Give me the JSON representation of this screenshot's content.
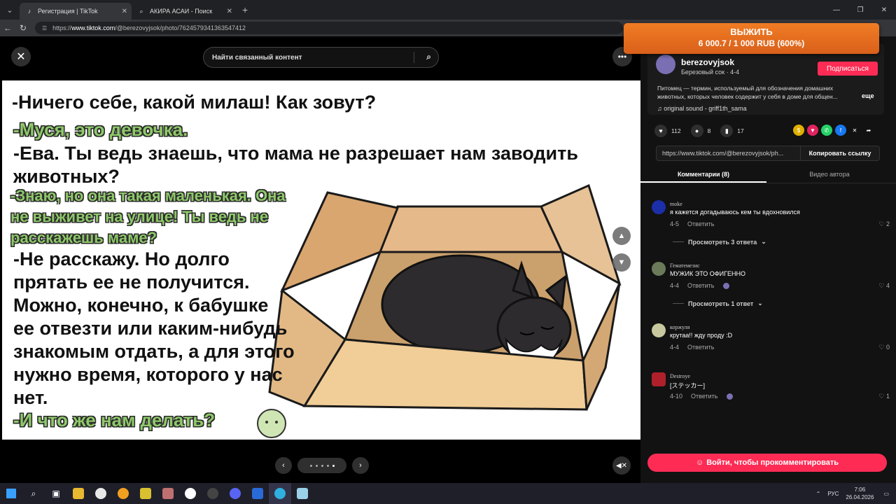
{
  "browser": {
    "tabs": [
      {
        "label": "Регистрация | TikTok",
        "icon": "tiktok-icon",
        "active": true
      },
      {
        "label": "АКИРА АСАИ - Поиск",
        "icon": "search-icon",
        "active": false
      }
    ],
    "url_prefix": "https://",
    "url_host": "www.tiktok.com",
    "url_path": "/@berezovyjsok/photo/7624579341363547412"
  },
  "viewer": {
    "search_placeholder": "Найти связанный контент",
    "comic_lines": [
      {
        "text": "-Ничего себе, какой милаш! Как зовут?",
        "style": "black"
      },
      {
        "text": "-Муся, это девочка.",
        "style": "green"
      },
      {
        "text": "-Ева. Ты ведь знаешь, что мама не разрешает нам заводить",
        "style": "black"
      },
      {
        "text": "животных?",
        "style": "black"
      },
      {
        "text": "-Знаю, но она такая маленькая. Она",
        "style": "green small"
      },
      {
        "text": "не выживет на улице! Ты ведь не",
        "style": "green small"
      },
      {
        "text": "расскажешь маме?",
        "style": "green small"
      },
      {
        "text": "-Не расскажу. Но долго",
        "style": "black"
      },
      {
        "text": "прятать ее не получится.",
        "style": "black"
      },
      {
        "text": "Можно, конечно, к бабушке",
        "style": "black"
      },
      {
        "text": "ее отвезти или каким-нибудь",
        "style": "black"
      },
      {
        "text": "знакомым отдать, а для этого",
        "style": "black"
      },
      {
        "text": "нужно время, которого у нас",
        "style": "black"
      },
      {
        "text": "нет.",
        "style": "black"
      },
      {
        "text": "-И что же нам делать?",
        "style": "green"
      }
    ],
    "pagination": {
      "total": 5,
      "current": 5
    }
  },
  "donation": {
    "title": "ВЫЖИТЬ",
    "progress": "6 000.7 / 1 000 RUB (600%)"
  },
  "author": {
    "name": "berezovyjsok",
    "subtitle": "Березовый сок · 4-4",
    "follow_label": "Подписаться",
    "description": "Питомец — термин, используемый для обозначения домашних животных, которых человек содержит у себя в доме для общен...",
    "more_label": "еще",
    "sound": "original sound - griff1th_sama"
  },
  "stats": {
    "likes": "112",
    "comments": "8",
    "saves": "17"
  },
  "share_link": {
    "url": "https://www.tiktok.com/@berezovyjsok/ph...",
    "copy_label": "Копировать ссылку"
  },
  "comment_tabs": [
    {
      "label": "Комментарии (8)",
      "active": true
    },
    {
      "label": "Видео автора",
      "active": false
    }
  ],
  "comments": [
    {
      "user": "moke",
      "text": "я кажется догадываюсь кем ты вдохновился",
      "date": "4-5",
      "reply": "Ответить",
      "likes": "2",
      "avatar_color": "#1b2fa8",
      "replies_label": "Просмотреть 3 ответа",
      "creator_liked": false
    },
    {
      "user": "Гематемезис",
      "text": "МУЖИК ЭТО ОФИГЕННО",
      "date": "4-4",
      "reply": "Ответить",
      "likes": "4",
      "avatar_color": "#6b7b5a",
      "replies_label": "Просмотреть 1 ответ",
      "creator_liked": true
    },
    {
      "user": "коржуля",
      "text": "крутаа!! жду проду :D",
      "date": "4-4",
      "reply": "Ответить",
      "likes": "0",
      "avatar_color": "#c8c8a0",
      "replies_label": "",
      "creator_liked": false
    },
    {
      "user": "Destroye",
      "text": "[ステッカー]",
      "date": "4-10",
      "reply": "Ответить",
      "likes": "1",
      "avatar_color": "#b0202a",
      "replies_label": "",
      "creator_liked": true
    }
  ],
  "login_prompt": "Войти, чтобы прокомментировать",
  "taskbar": {
    "lang": "РУС",
    "time": "7:06",
    "date": "26.04.2026"
  }
}
